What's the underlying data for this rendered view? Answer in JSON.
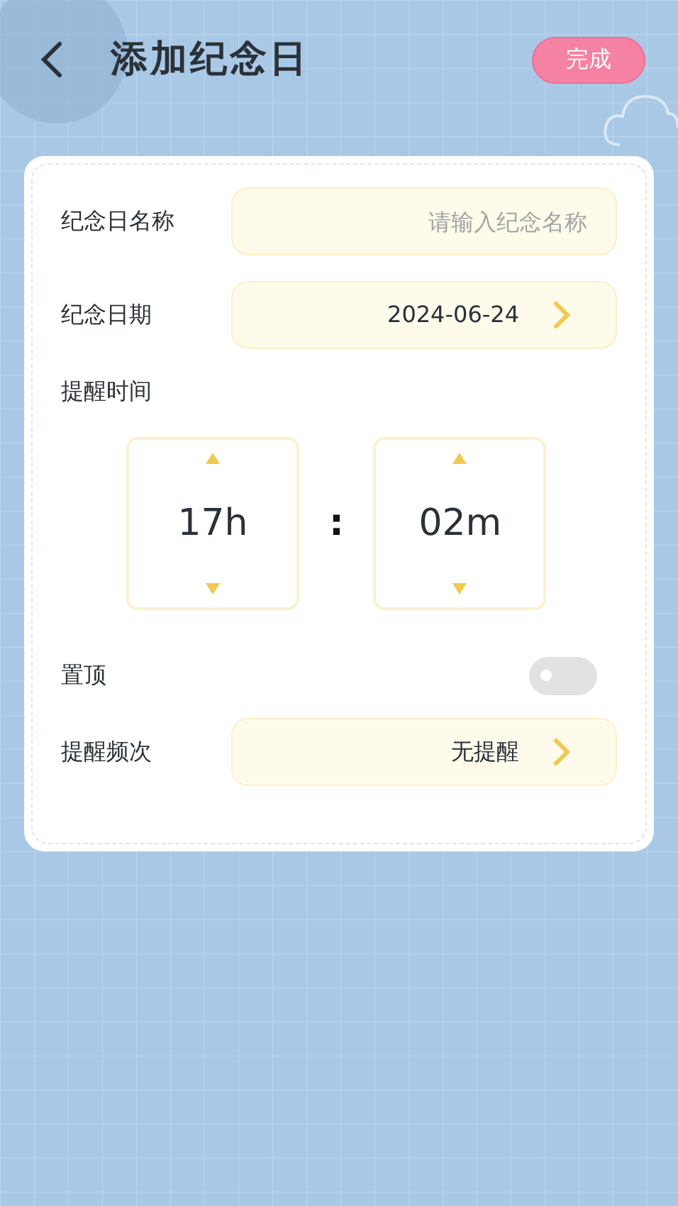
{
  "header": {
    "title": "添加纪念日",
    "done_button": "完成"
  },
  "form": [
    {
      "kind": "input",
      "label": "纪念日名称",
      "placeholder": "请输入纪念名称"
    },
    {
      "kind": "select",
      "label": "纪念日期",
      "value": "2024-06-24"
    },
    {
      "kind": "time",
      "label": "提醒时间",
      "hour": "17h",
      "separator": ":",
      "minute": "02m"
    },
    {
      "kind": "toggle",
      "label": "置顶",
      "on": false
    },
    {
      "kind": "select",
      "label": "提醒频次",
      "value": "无提醒"
    }
  ]
}
